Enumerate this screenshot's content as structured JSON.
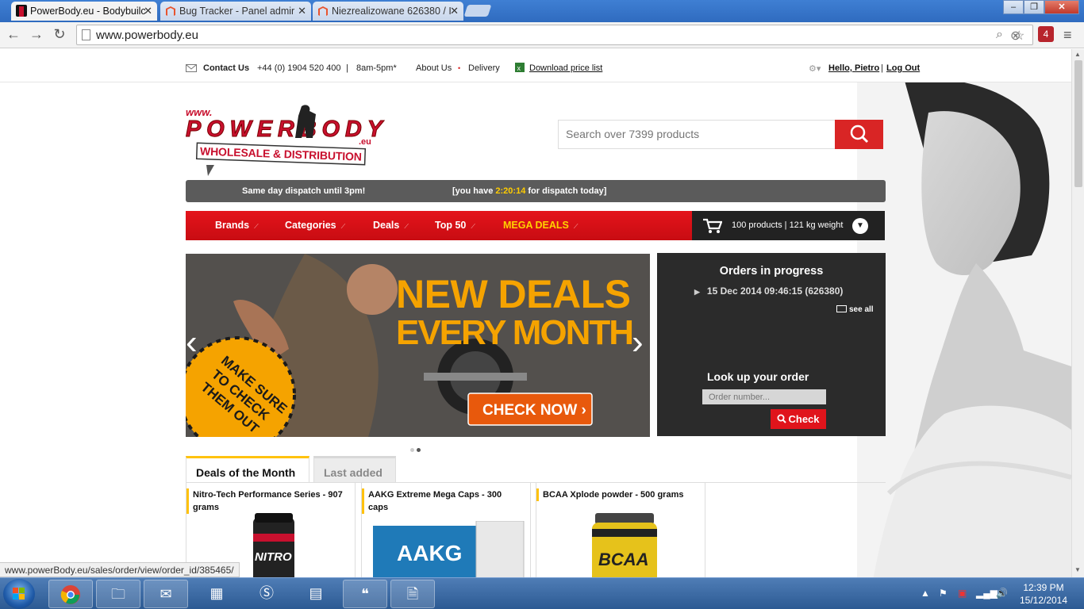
{
  "browser": {
    "tabs": [
      {
        "title": "PowerBody.eu - Bodybuilc",
        "active": true
      },
      {
        "title": "Bug Tracker - Panel admir",
        "active": false
      },
      {
        "title": "Niezrealizowane 626380 / I",
        "active": false
      }
    ],
    "url": "www.powerbody.eu",
    "extension_badge": "4",
    "status_url": "www.powerBody.eu/sales/order/view/order_id/385465/"
  },
  "topbar": {
    "contact_label": "Contact Us",
    "phone": "+44 (0) 1904 520 400",
    "sep": "|",
    "hours": "8am-5pm*",
    "about": "About Us",
    "bullet": "•",
    "delivery": "Delivery",
    "price_list": "Download price list",
    "hello": "Hello, Pietro",
    "logout": "Log Out"
  },
  "header": {
    "logo_top": "www.",
    "logo_main": "POWERBODY",
    "logo_eu": ".eu",
    "logo_sub": "WHOLESALE & DISTRIBUTION",
    "search_placeholder": "Search over 7399 products"
  },
  "dispatch": {
    "left": "Same day dispatch until 3pm!",
    "pre": "[you have ",
    "timer": "2:20:14",
    "post": " for dispatch today]"
  },
  "nav": {
    "items": [
      {
        "label": "Brands"
      },
      {
        "label": "Categories"
      },
      {
        "label": "Deals"
      },
      {
        "label": "Top 50"
      },
      {
        "label": "MEGA DEALS"
      }
    ],
    "cart_summary": "100 products | 121 kg weight"
  },
  "banner": {
    "headline1": "NEW DEALS",
    "headline2": "EVERY MONTH",
    "cta": "CHECK NOW ›",
    "badge_l1": "MAKE SURE",
    "badge_l2": "TO CHECK",
    "badge_l3": "THEM OUT",
    "prev": "‹",
    "next": "›"
  },
  "orders": {
    "title": "Orders in progress",
    "order": "15 Dec 2014 09:46:15 (626380)",
    "see_all": "see all",
    "lookup_title": "Look up your order",
    "lookup_placeholder": "Order number...",
    "check": "Check"
  },
  "products": {
    "tabs": [
      {
        "label": "Deals of the Month",
        "active": true
      },
      {
        "label": "Last added",
        "active": false
      }
    ],
    "items": [
      {
        "name": "Nitro-Tech Performance Series - 907 grams",
        "img_text": "NITRO"
      },
      {
        "name": "AAKG Extreme Mega Caps - 300 caps",
        "img_text": "AAKG"
      },
      {
        "name": "BCAA Xplode powder - 500 grams",
        "img_text": "BCAA"
      }
    ]
  },
  "taskbar": {
    "clock_time": "12:39 PM",
    "clock_date": "15/12/2014"
  },
  "colors": {
    "brand_red": "#d92525",
    "accent_yellow": "#ffc20e",
    "dark_panel": "#2b2b2b"
  }
}
